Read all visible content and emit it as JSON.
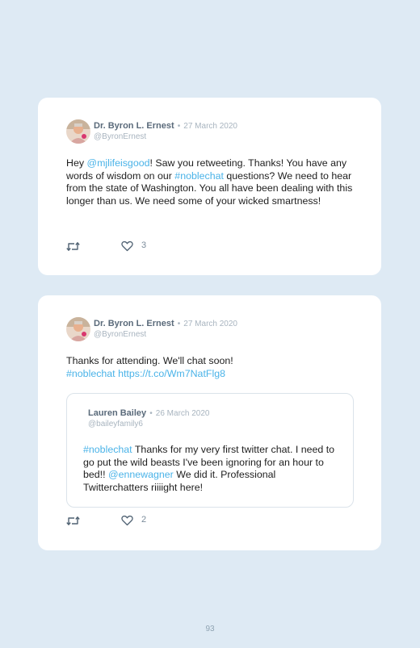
{
  "tweets": [
    {
      "author_name": "Dr. Byron L. Ernest",
      "date": "27 March 2020",
      "handle": "@ByronErnest",
      "segments": [
        {
          "text": "Hey ",
          "link": false
        },
        {
          "text": "@mjlifeisgood",
          "link": true
        },
        {
          "text": "! Saw you retweeting. Thanks! You have any words of wisdom on our ",
          "link": false
        },
        {
          "text": "#noblechat",
          "link": true
        },
        {
          "text": " questions? We need to hear from the state of Washington. You all have been dealing with this longer than us. We need some of your wicked smartness!",
          "link": false
        }
      ],
      "likes": "3"
    },
    {
      "author_name": "Dr. Byron L. Ernest",
      "date": "27 March 2020",
      "handle": "@ByronErnest",
      "line1": "Thanks for attending. We'll chat soon!",
      "hashtag": "#noblechat",
      "url": "https://t.co/Wm7NatFlg8",
      "likes": "2",
      "quote": {
        "author_name": "Lauren Bailey",
        "date": "26 March 2020",
        "handle": "@baileyfamily6",
        "hashtag": "#noblechat",
        "text_a": " Thanks for my very first twitter chat. I need to go put the wild beasts I've been ignoring for an hour to bed!! ",
        "mention": "@ennewagner",
        "text_b": " We did it. Professional Twitterchatters riiiight here!"
      }
    }
  ],
  "separator": "•",
  "page_number": "93",
  "icons": [
    "avatar",
    "retweet-icon",
    "heart-icon"
  ],
  "colors": {
    "background": "#deeaf4",
    "card": "#ffffff",
    "link": "#4ab3e8",
    "name": "#5a6a7a",
    "muted": "#a8b4bf"
  }
}
